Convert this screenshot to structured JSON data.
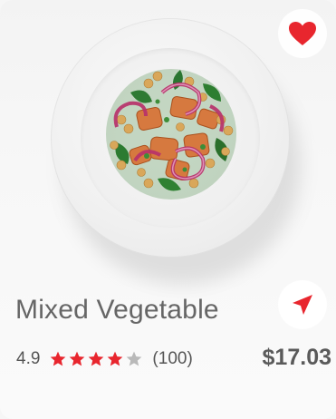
{
  "product": {
    "name": "Mixed Vegetable",
    "rating_value": "4.9",
    "rating": 4.9,
    "stars_total": 5,
    "stars_filled": 4,
    "reviews": "(100)",
    "price": "$17.03"
  },
  "colors": {
    "accent": "#e8262e",
    "star_empty": "#b9b9b9",
    "text": "#666666"
  },
  "icons": {
    "favorite": "heart-icon",
    "navigate": "navigation-arrow-icon",
    "rating": "star-icon"
  }
}
